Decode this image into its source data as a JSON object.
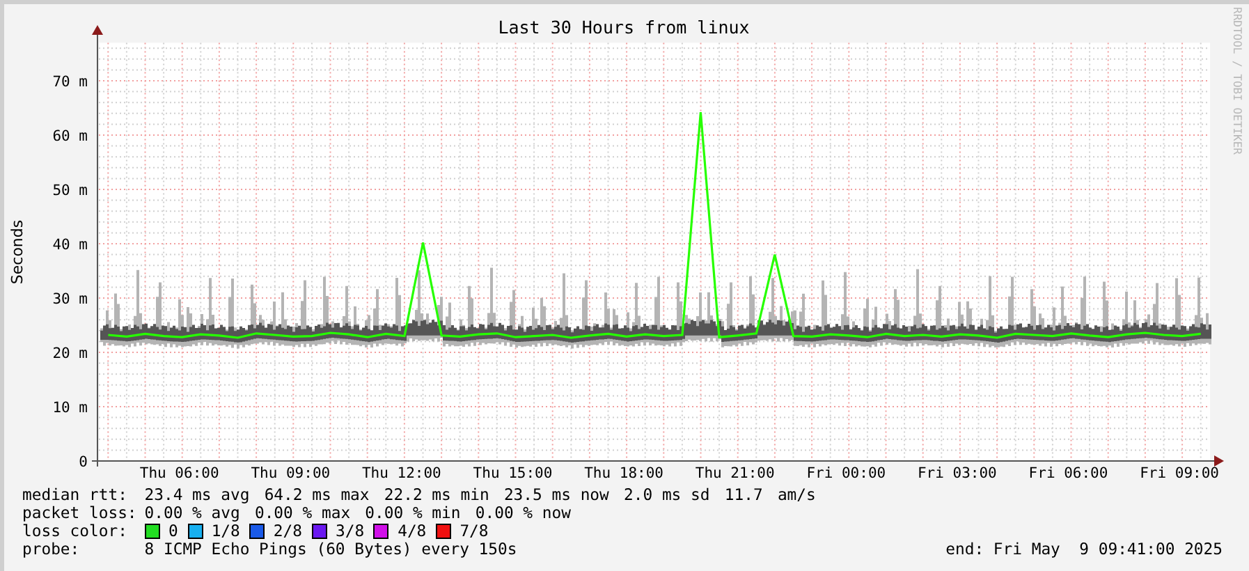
{
  "graph": {
    "credit": "RRDTOOL / TOBI OETIKER",
    "chart_data": {
      "type": "line",
      "grid": true,
      "title": "Last 30 Hours from linux",
      "ylabel": "Seconds",
      "ylim": [
        0,
        77
      ],
      "categories": [
        null,
        null,
        null,
        null,
        "Thu 06:00",
        null,
        null,
        null,
        null,
        null,
        "Thu 09:00",
        null,
        null,
        null,
        null,
        null,
        "Thu 12:00",
        null,
        null,
        null,
        null,
        null,
        "Thu 15:00",
        null,
        null,
        null,
        null,
        null,
        "Thu 18:00",
        null,
        null,
        null,
        null,
        null,
        "Thu 21:00",
        null,
        null,
        null,
        null,
        null,
        "Fri 00:00",
        null,
        null,
        null,
        null,
        null,
        "Fri 03:00",
        null,
        null,
        null,
        null,
        null,
        "Fri 06:00",
        null,
        null,
        null,
        null,
        null,
        "Fri 09:00",
        null
      ],
      "yticks": [
        {
          "value": 0,
          "label": "0"
        },
        {
          "value": 10,
          "label": "10 m"
        },
        {
          "value": 20,
          "label": "20 m"
        },
        {
          "value": 30,
          "label": "30 m"
        },
        {
          "value": 40,
          "label": "40 m"
        },
        {
          "value": 50,
          "label": "50 m"
        },
        {
          "value": 60,
          "label": "60 m"
        },
        {
          "value": 70,
          "label": "70 m"
        }
      ],
      "series": [
        {
          "name": "median rtt:",
          "color": "#26ff00",
          "values": [
            23.2,
            22.9,
            23.4,
            23.0,
            22.8,
            23.3,
            23.1,
            22.7,
            23.5,
            23.2,
            22.9,
            23.0,
            23.6,
            23.3,
            22.8,
            23.4,
            23.0,
            40.2,
            23.1,
            22.9,
            23.3,
            23.5,
            22.8,
            23.0,
            23.2,
            22.7,
            23.1,
            23.4,
            22.9,
            23.3,
            23.0,
            23.2,
            64.2,
            22.8,
            23.1,
            23.5,
            38.0,
            23.0,
            22.9,
            23.3,
            23.1,
            22.8,
            23.4,
            23.0,
            23.2,
            22.9,
            23.3,
            23.1,
            22.7,
            23.4,
            23.2,
            23.0,
            23.5,
            23.1,
            22.8,
            23.3,
            23.6,
            23.2,
            23.0,
            23.4
          ]
        }
      ]
    }
  },
  "legend": {
    "median_rtt": {
      "stats": [
        "23.4 ms avg",
        "64.2 ms max",
        "22.2 ms min",
        "23.5 ms now",
        "2.0 ms sd",
        "11.7",
        "am/s"
      ]
    },
    "packet_loss": {
      "label": "packet loss:",
      "stats": [
        "0.00 % avg",
        "0.00 % max",
        "0.00 % min",
        "0.00 % now"
      ]
    },
    "loss_color": {
      "label": "loss color:",
      "items": [
        {
          "label": "0",
          "color": "#22dd22"
        },
        {
          "label": "1/8",
          "color": "#18b0f0"
        },
        {
          "label": "2/8",
          "color": "#1a5ae8"
        },
        {
          "label": "3/8",
          "color": "#6a18f0"
        },
        {
          "label": "4/8",
          "color": "#d010e8"
        },
        {
          "label": "7/8",
          "color": "#f01010"
        }
      ]
    },
    "probe": {
      "label": "probe:",
      "text": "8 ICMP Echo Pings (60 Bytes) every 150s",
      "end": "end: Fri May  9 09:41:00 2025"
    }
  }
}
